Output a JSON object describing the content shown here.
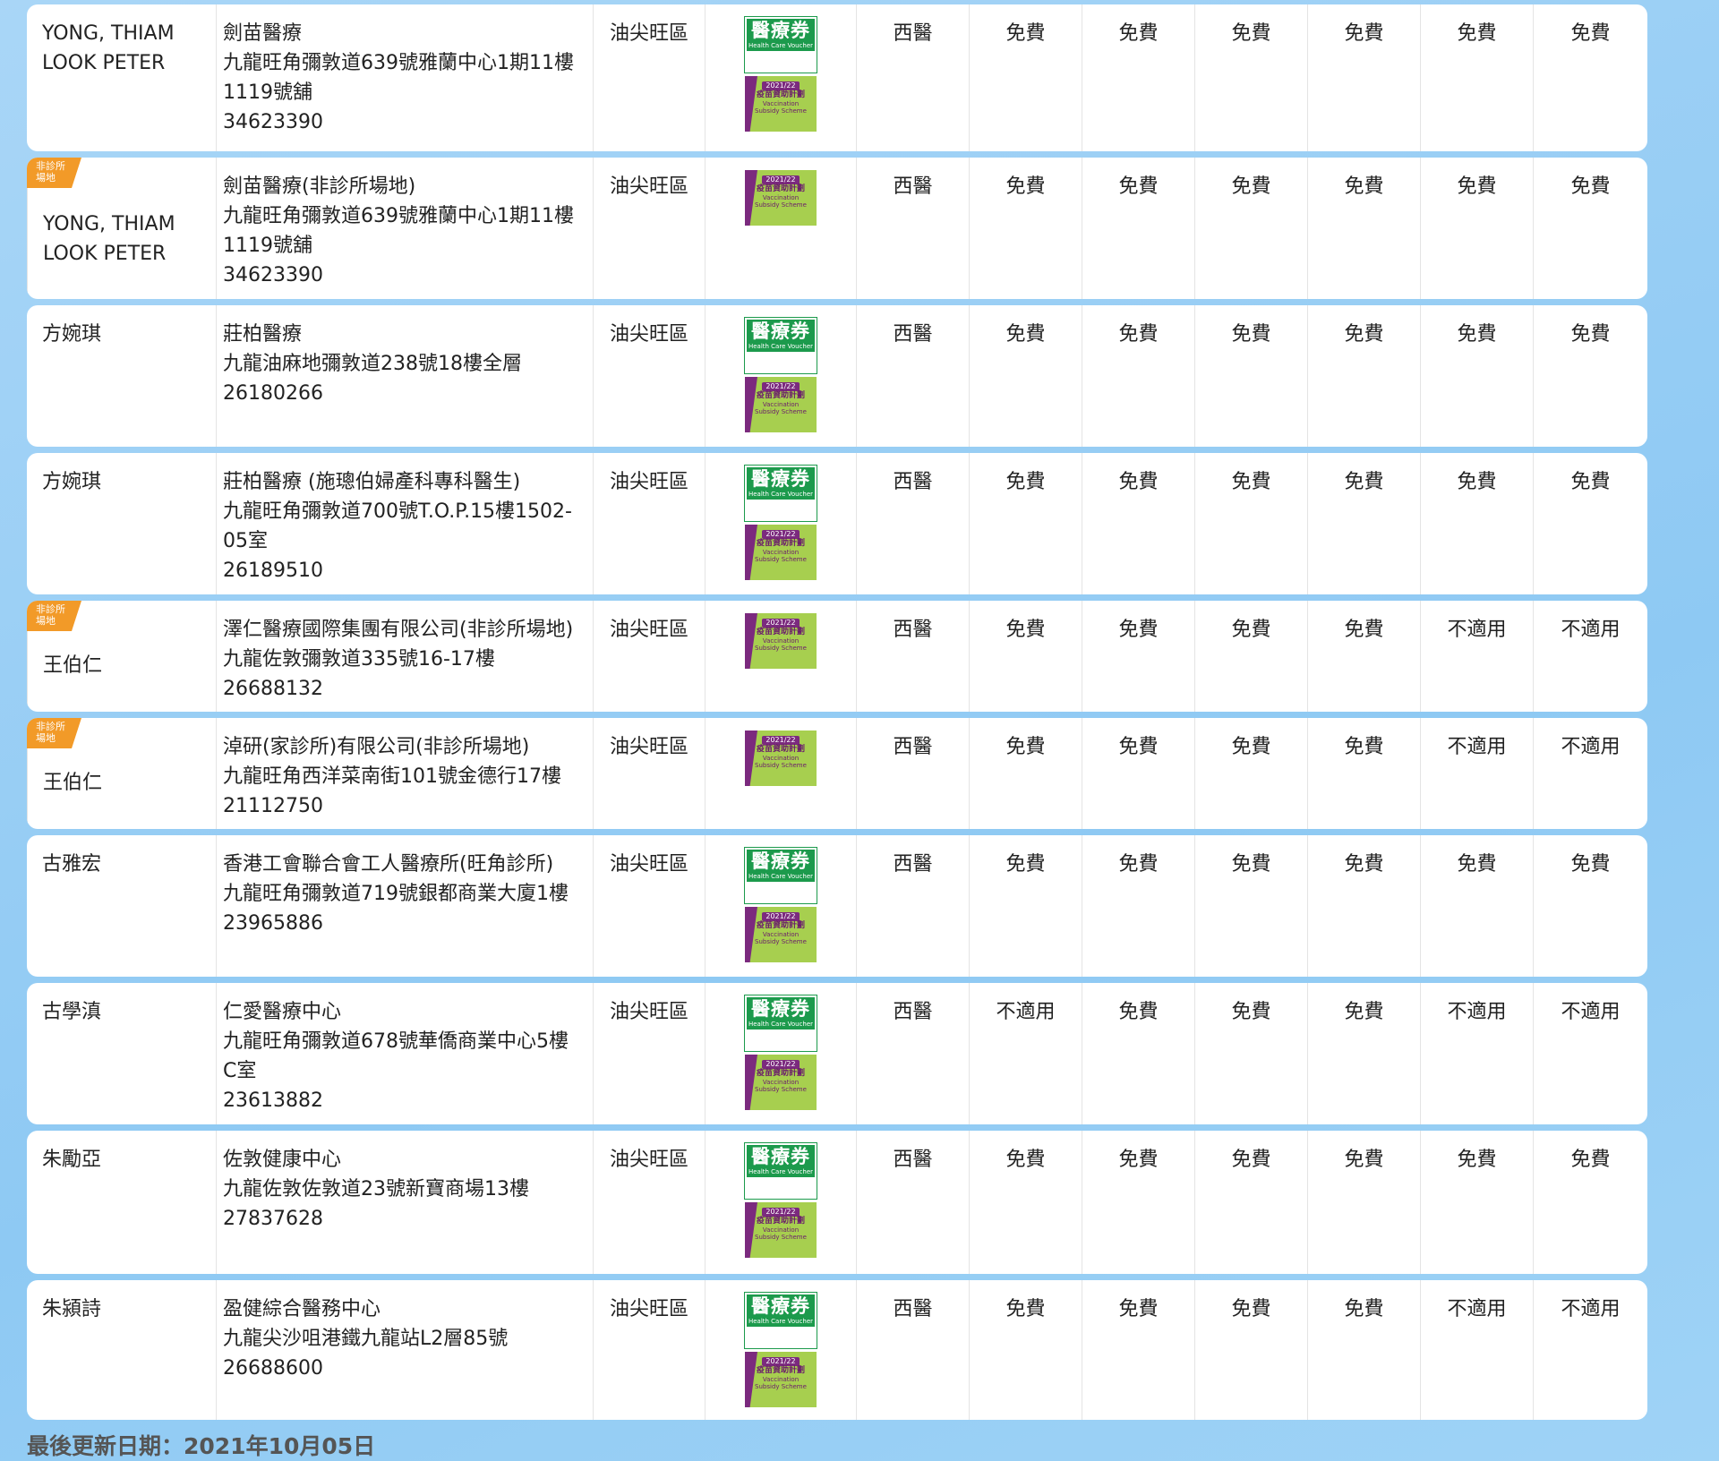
{
  "badge_labels": [
    "非診所",
    "場地"
  ],
  "logos": {
    "health_care_voucher": {
      "title": "醫療券",
      "subtitle": "Health Care Voucher"
    },
    "vaccination_subsidy": {
      "year": "2021/22",
      "title": "疫苗資助計劃",
      "line1": "Vaccination",
      "line2": "Subsidy Scheme"
    }
  },
  "colors": {
    "accent_green": "#1c9a4c",
    "badge_orange": "#f29a28",
    "vss_green": "#a7cf4f",
    "vss_purple": "#7b2a7e"
  },
  "rows": [
    {
      "name": "YONG, THIAM\nLOOK PETER",
      "non_clinic": false,
      "clinic": [
        "劍苗醫療",
        "九龍旺角彌敦道639號雅蘭中心1期11樓",
        "1119號舖",
        "34623390"
      ],
      "district": "油尖旺區",
      "voucher": true,
      "vss": true,
      "type": "西醫",
      "svc": [
        "免費",
        "免費",
        "免費",
        "免費",
        "免費",
        "免費"
      ]
    },
    {
      "name": "YONG, THIAM\nLOOK PETER",
      "non_clinic": true,
      "clinic": [
        "劍苗醫療(非診所場地)",
        "九龍旺角彌敦道639號雅蘭中心1期11樓",
        "1119號舖",
        "34623390"
      ],
      "district": "油尖旺區",
      "voucher": false,
      "vss": true,
      "type": "西醫",
      "svc": [
        "免費",
        "免費",
        "免費",
        "免費",
        "免費",
        "免費"
      ]
    },
    {
      "name": "方婉琪",
      "non_clinic": false,
      "clinic": [
        "莊柏醫療",
        "九龍油麻地彌敦道238號18樓全層",
        "26180266"
      ],
      "district": "油尖旺區",
      "voucher": true,
      "vss": true,
      "type": "西醫",
      "svc": [
        "免費",
        "免費",
        "免費",
        "免費",
        "免費",
        "免費"
      ]
    },
    {
      "name": "方婉琪",
      "non_clinic": false,
      "clinic": [
        "莊柏醫療 (施璁伯婦產科專科醫生)",
        "九龍旺角彌敦道700號T.O.P.15樓1502-",
        "05室",
        "26189510"
      ],
      "district": "油尖旺區",
      "voucher": true,
      "vss": true,
      "type": "西醫",
      "svc": [
        "免費",
        "免費",
        "免費",
        "免費",
        "免費",
        "免費"
      ]
    },
    {
      "name": "王伯仁",
      "non_clinic": true,
      "clinic": [
        "澤仁醫療國際集團有限公司(非診所場地)",
        "九龍佐敦彌敦道335號16-17樓",
        "26688132"
      ],
      "district": "油尖旺區",
      "voucher": false,
      "vss": true,
      "type": "西醫",
      "svc": [
        "免費",
        "免費",
        "免費",
        "免費",
        "不適用",
        "不適用"
      ]
    },
    {
      "name": "王伯仁",
      "non_clinic": true,
      "clinic": [
        "淖研(家診所)有限公司(非診所場地)",
        "九龍旺角西洋菜南街101號金德行17樓",
        "21112750"
      ],
      "district": "油尖旺區",
      "voucher": false,
      "vss": true,
      "type": "西醫",
      "svc": [
        "免費",
        "免費",
        "免費",
        "免費",
        "不適用",
        "不適用"
      ]
    },
    {
      "name": "古雅宏",
      "non_clinic": false,
      "clinic": [
        "香港工會聯合會工人醫療所(旺角診所)",
        "九龍旺角彌敦道719號銀都商業大廈1樓",
        "23965886"
      ],
      "district": "油尖旺區",
      "voucher": true,
      "vss": true,
      "type": "西醫",
      "svc": [
        "免費",
        "免費",
        "免費",
        "免費",
        "免費",
        "免費"
      ]
    },
    {
      "name": "古學滇",
      "non_clinic": false,
      "clinic": [
        "仁愛醫療中心",
        "九龍旺角彌敦道678號華僑商業中心5樓",
        "C室",
        "23613882"
      ],
      "district": "油尖旺區",
      "voucher": true,
      "vss": true,
      "type": "西醫",
      "svc": [
        "不適用",
        "免費",
        "免費",
        "免費",
        "不適用",
        "不適用"
      ]
    },
    {
      "name": "朱勵亞",
      "non_clinic": false,
      "clinic": [
        "佐敦健康中心",
        "九龍佐敦佐敦道23號新寶商場13樓",
        "27837628"
      ],
      "district": "油尖旺區",
      "voucher": true,
      "vss": true,
      "type": "西醫",
      "svc": [
        "免費",
        "免費",
        "免費",
        "免費",
        "免費",
        "免費"
      ]
    },
    {
      "name": "朱潁詩",
      "non_clinic": false,
      "clinic": [
        "盈健綜合醫務中心",
        "九龍尖沙咀港鐵九龍站L2層85號",
        "26688600"
      ],
      "district": "油尖旺區",
      "voucher": true,
      "vss": true,
      "type": "西醫",
      "svc": [
        "免費",
        "免費",
        "免費",
        "免費",
        "不適用",
        "不適用"
      ]
    }
  ],
  "footer": "最後更新日期：2021年10月05日"
}
